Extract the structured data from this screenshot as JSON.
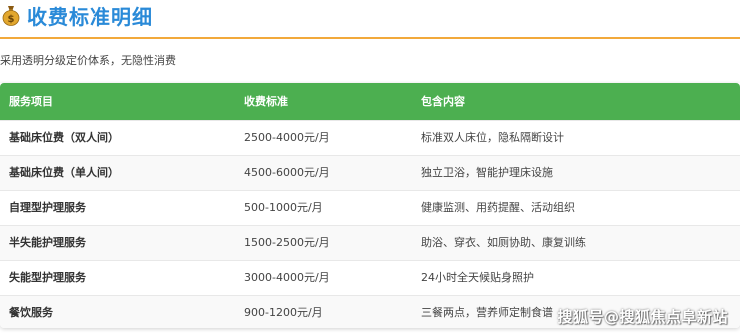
{
  "header": {
    "icon": "money-bag-icon",
    "title": "收费标准明细"
  },
  "subtitle": "采用透明分级定价体系，无隐性消费",
  "table": {
    "headers": [
      "服务项目",
      "收费标准",
      "包含内容"
    ],
    "rows": [
      [
        "基础床位费（双人间）",
        "2500-4000元/月",
        "标准双人床位，隐私隔断设计"
      ],
      [
        "基础床位费（单人间）",
        "4500-6000元/月",
        "独立卫浴，智能护理床设施"
      ],
      [
        "自理型护理服务",
        "500-1000元/月",
        "健康监测、用药提醒、活动组织"
      ],
      [
        "半失能护理服务",
        "1500-2500元/月",
        "助浴、穿衣、如厕协助、康复训练"
      ],
      [
        "失能型护理服务",
        "3000-4000元/月",
        "24小时全天候贴身照护"
      ],
      [
        "餐饮服务",
        "900-1200元/月",
        "三餐两点，营养师定制食谱"
      ]
    ]
  },
  "watermark": "搜狐号@搜狐焦点阜新站",
  "colors": {
    "title": "#2a8ad8",
    "header_rule": "#f2a93b",
    "table_header": "#4caf50"
  }
}
